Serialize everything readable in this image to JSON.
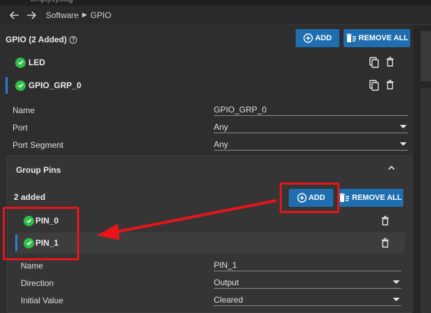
{
  "window": {
    "title_fragment": "emptysysctg"
  },
  "breadcrumb": [
    "Software",
    "GPIO"
  ],
  "gpio": {
    "title": "GPIO (2 Added)",
    "add_label": "ADD",
    "remove_all_label": "REMOVE ALL",
    "items": [
      {
        "label": "LED",
        "status": "valid"
      },
      {
        "label": "GPIO_GRP_0",
        "status": "valid",
        "selected": true
      }
    ]
  },
  "properties": {
    "name_label": "Name",
    "name_value": "GPIO_GRP_0",
    "port_label": "Port",
    "port_value": "Any",
    "port_segment_label": "Port Segment",
    "port_segment_value": "Any"
  },
  "group_pins": {
    "title": "Group Pins",
    "count_label": "2 added",
    "add_label": "ADD",
    "remove_all_label": "REMOVE ALL",
    "pins": [
      {
        "label": "PIN_0",
        "status": "valid"
      },
      {
        "label": "PIN_1",
        "status": "valid",
        "selected": true
      }
    ]
  },
  "pin_properties": {
    "name_label": "Name",
    "name_value": "PIN_1",
    "direction_label": "Direction",
    "direction_value": "Output",
    "initial_value_label": "Initial Value",
    "initial_value_value": "Cleared"
  },
  "colors": {
    "accent": "#1f6fb0",
    "valid": "#2fbf4a",
    "selection": "#2d7fd3",
    "annotation": "#e8141a"
  },
  "icons": [
    "back-arrow-icon",
    "forward-arrow-icon",
    "help-icon",
    "plus-circle-icon",
    "trash-list-icon",
    "copy-icon",
    "trash-icon",
    "check-circle-icon",
    "chevron-up-icon",
    "dropdown-arrow-icon"
  ]
}
